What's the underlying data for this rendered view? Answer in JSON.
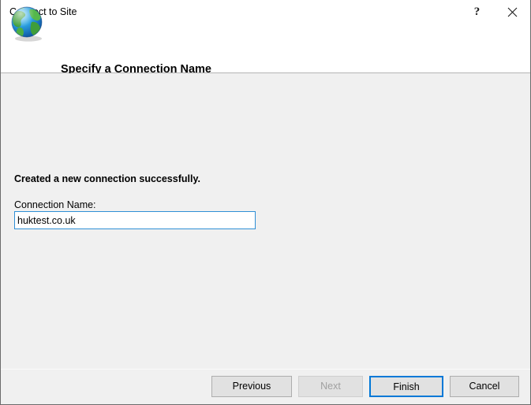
{
  "window": {
    "title": "Connect to Site",
    "help_icon": "help-question-icon",
    "help_glyph": "?",
    "close_icon": "close-icon"
  },
  "header": {
    "icon": "globe-icon",
    "heading": "Specify a Connection Name"
  },
  "content": {
    "status_message": "Created a new connection successfully.",
    "field_label": "Connection Name:",
    "connection_name_value": "huktest.co.uk",
    "connection_name_placeholder": ""
  },
  "footer": {
    "buttons": [
      {
        "label": "Previous",
        "state": "enabled"
      },
      {
        "label": "Next",
        "state": "disabled"
      },
      {
        "label": "Finish",
        "state": "focused"
      },
      {
        "label": "Cancel",
        "state": "enabled"
      }
    ]
  },
  "colors": {
    "accent": "#0078D7",
    "dialog_background": "#F0F0F0",
    "header_background": "#FFFFFF",
    "button_face": "#E1E1E1",
    "button_border": "#ADADAD",
    "input_border_focused": "#2F8FD6",
    "disabled_text": "#A0A0A0",
    "window_border": "#6B6B6B"
  }
}
